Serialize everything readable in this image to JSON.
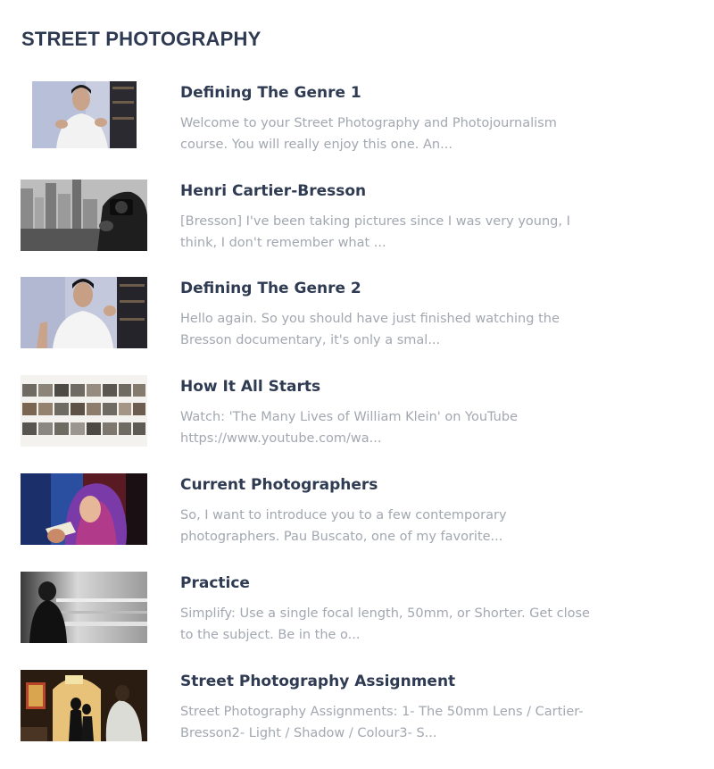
{
  "section": {
    "title": "STREET PHOTOGRAPHY"
  },
  "lessons": [
    {
      "title": "Defining The Genre 1",
      "description": "Welcome to your Street Photography and Photojournalism course. You will really enjoy this one. An...",
      "thumbnail_icon": "instructor-talking-image"
    },
    {
      "title": "Henri Cartier-Bresson",
      "description": "[Bresson] I've been taking pictures since I was very young, I think, I don't remember what ...",
      "thumbnail_icon": "photographer-city-image"
    },
    {
      "title": "Defining The Genre 2",
      "description": "Hello again. So you should have just finished watching the Bresson documentary, it's only a smal...",
      "thumbnail_icon": "instructor-talking-image"
    },
    {
      "title": "How It All Starts",
      "description": "Watch: 'The Many Lives of William Klein' on YouTube https://www.youtube.com/wa...",
      "thumbnail_icon": "contact-sheet-image"
    },
    {
      "title": "Current Photographers",
      "description": "So, I want to introduce you to a few contemporary photographers. Pau Buscato, one of my favorite...",
      "thumbnail_icon": "colorful-street-image"
    },
    {
      "title": "Practice",
      "description": "Simplify: Use a single focal length, 50mm, or Shorter. Get close to the subject. Be in the o...",
      "thumbnail_icon": "motion-blur-figure-image"
    },
    {
      "title": "Street Photography Assignment",
      "description": "Street Photography Assignments: 1- The 50mm Lens / Cartier-Bresson2- Light / Shadow / Colour3- S...",
      "thumbnail_icon": "silhouette-street-image"
    }
  ],
  "colors": {
    "heading": "#2e3a52",
    "lesson_title": "#2f3b52",
    "description": "#a2a7b0",
    "background": "#ffffff"
  }
}
